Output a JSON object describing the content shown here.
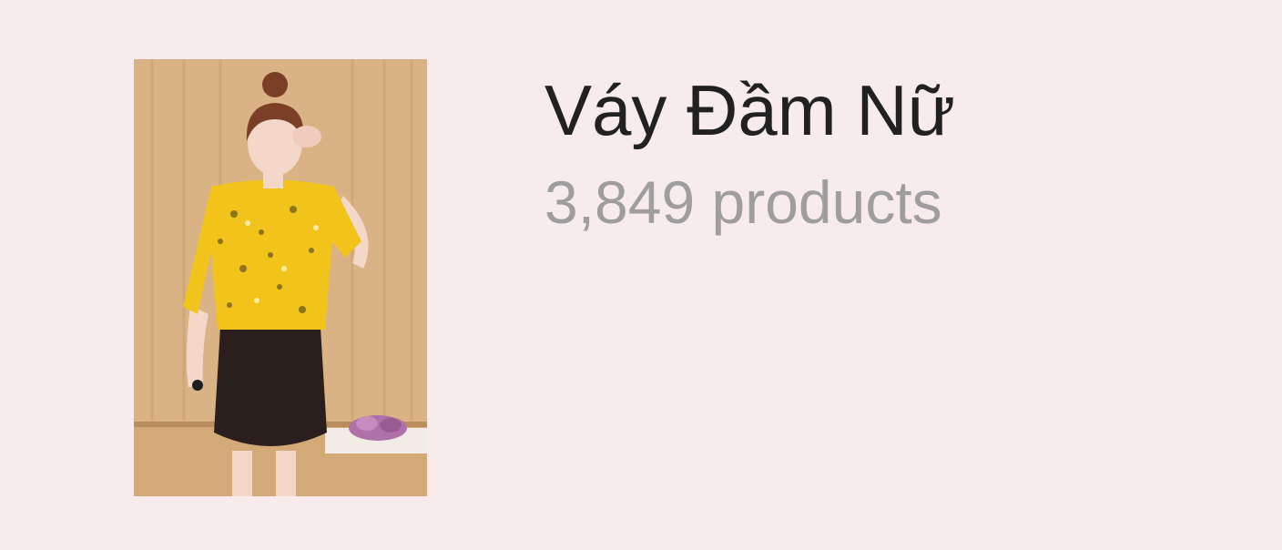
{
  "category": {
    "title": "Váy Đầm Nữ",
    "product_count": "3,849",
    "product_count_unit": "products",
    "image_icon": "category-photo-icon"
  },
  "colors": {
    "background": "#f8ebec",
    "title": "#212121",
    "subtitle": "#9e9e9e",
    "blouse": "#f2c31a",
    "skirt": "#2a1f1c"
  }
}
